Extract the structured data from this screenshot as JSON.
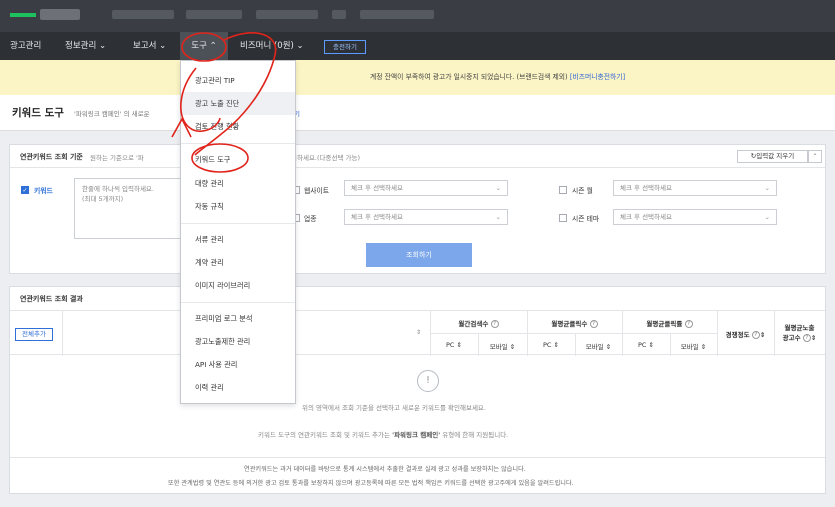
{
  "nav": {
    "items": [
      {
        "label": "광고관리"
      },
      {
        "label": "정보관리 ⌄"
      },
      {
        "label": "보고서 ⌄"
      },
      {
        "label": "도구 ⌃"
      },
      {
        "label": "비즈머니 (0원) ⌄"
      }
    ],
    "charge_label": "충전하기"
  },
  "notice": {
    "message": "계정 잔액이 부족하여 광고가 일시중지 되었습니다. (브랜드검색 제외) ",
    "link": "[비즈머니충전하기]"
  },
  "page": {
    "title": "키워드 도구",
    "subtitle": "'파워링크 캠페인' 의 새로운",
    "subtitle_link": "기"
  },
  "search_panel": {
    "title": "연관키워드 조회 기준",
    "hint": "원하는 기준으로 '파",
    "hint2": "회하세요.(다중선택 가능)",
    "reset_label": "↻입력값 지우기",
    "fold_label": "⌃",
    "keyword": {
      "label": "키워드",
      "check": "✓",
      "placeholder_line1": "한줄에 하나씩 입력하세요.",
      "placeholder_line2": "(최대 5개까지)"
    },
    "website": {
      "label": "웹사이트",
      "placeholder": "체크 후 선택하세요"
    },
    "industry": {
      "label": "업종",
      "placeholder": "체크 후 선택하세요"
    },
    "season_month": {
      "label": "시즌 월",
      "placeholder": "체크 후 선택하세요"
    },
    "season_theme": {
      "label": "시즌 테마",
      "placeholder": "체크 후 선택하세요"
    },
    "chevron": "⌄",
    "search_label": "조회하기"
  },
  "results_panel": {
    "title": "연관키워드 조회 결과",
    "add_all_label": "전체추가",
    "sort_glyph": "⇕",
    "help_glyph": "?",
    "columns": {
      "monthly_search": "월간검색수",
      "monthly_avg_clicks": "월평균클릭수",
      "monthly_avg_ctr": "월평균클릭률",
      "competition": "경쟁정도",
      "avg_ad_exposure_1": "월평균노출",
      "avg_ad_exposure_2": "광고수"
    },
    "sub_columns": {
      "pc": "PC",
      "mobile": "모바일"
    },
    "empty_icon": "!",
    "empty_line1": "위의 영역에서 조회 기준을 선택하고 새로운 키워드를 확인해보세요.",
    "empty_line2_prefix": "키워드 도구의 연관키워드 조회 및 키워드 추가는 ",
    "empty_line2_bold": "'파워링크 캠페인'",
    "empty_line2_suffix": " 유형에 한해 지원됩니다.",
    "foot1": "연관키워드는 과거 데이터를 바탕으로 통계 시스템에서 추출한 결과로 실제 광고 성과를 보장하지는 않습니다.",
    "foot2": "또한 관계법령 및 연관도 등에 의거한 광고 검토 통과를 보장하지 않으며 광고등록에 따른 모든 법적 책임은 키워드를 선택한 광고주에게 있음을 알려드립니다."
  },
  "dropdown": {
    "items": [
      "광고관리 TIP",
      "광고 노출 진단",
      "검토 진행 현황",
      "키워드 도구",
      "대량 관리",
      "자동 규칙",
      "서류 관리",
      "계약 관리",
      "이미지 라이브러리",
      "프리미엄 로그 분석",
      "광고노출제한 관리",
      "API 사용 관리",
      "이력 관리"
    ]
  },
  "colors": {
    "annotation_red": "#e0241b",
    "accent_blue": "#2f6fd8",
    "nav_bg": "#2d3136",
    "notice_bg": "#fbf4c4"
  }
}
